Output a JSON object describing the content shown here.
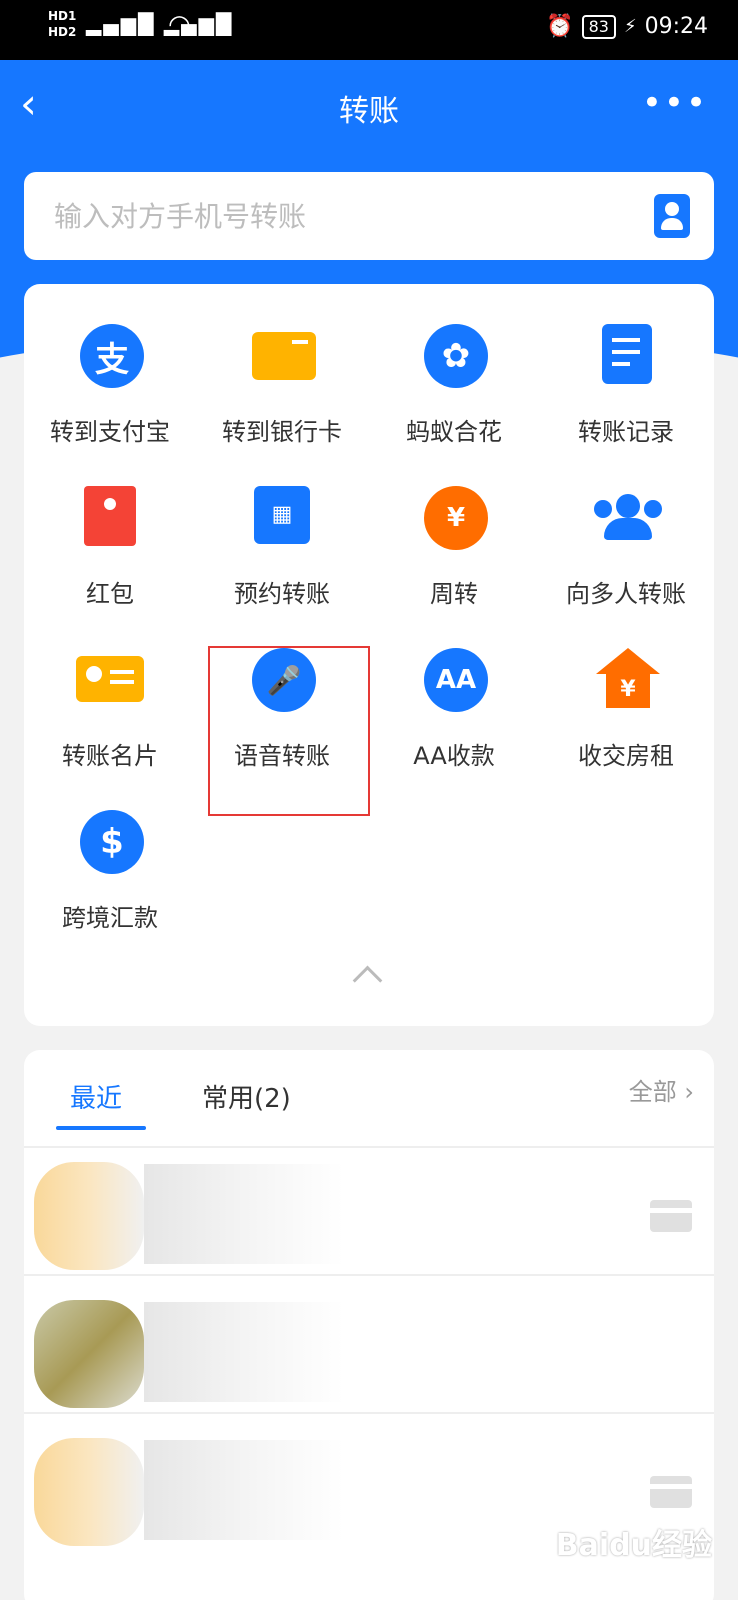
{
  "status_bar": {
    "left_label": "HD1\nHD2",
    "battery": "83",
    "time": "09:24"
  },
  "nav": {
    "title": "转账"
  },
  "search": {
    "placeholder": "输入对方手机号转账"
  },
  "grid": [
    {
      "label": "转到支付宝",
      "icon": "alipay-icon"
    },
    {
      "label": "转到银行卡",
      "icon": "bank-card-icon"
    },
    {
      "label": "蚂蚁合花",
      "icon": "butterfly-icon"
    },
    {
      "label": "转账记录",
      "icon": "record-icon"
    },
    {
      "label": "红包",
      "icon": "red-envelope-icon"
    },
    {
      "label": "预约转账",
      "icon": "calendar-icon"
    },
    {
      "label": "周转",
      "icon": "yuan-hand-icon"
    },
    {
      "label": "向多人转账",
      "icon": "group-icon"
    },
    {
      "label": "转账名片",
      "icon": "name-card-icon"
    },
    {
      "label": "语音转账",
      "icon": "microphone-icon"
    },
    {
      "label": "AA收款",
      "icon": "aa-icon"
    },
    {
      "label": "收交房租",
      "icon": "house-icon"
    },
    {
      "label": "跨境汇款",
      "icon": "dollar-icon"
    }
  ],
  "tabs": {
    "recent": "最近",
    "frequent": "常用(2)",
    "all": "全部"
  },
  "colors": {
    "accent": "#1677ff",
    "highlight": "#e53935"
  },
  "watermark": "Baidu经验"
}
